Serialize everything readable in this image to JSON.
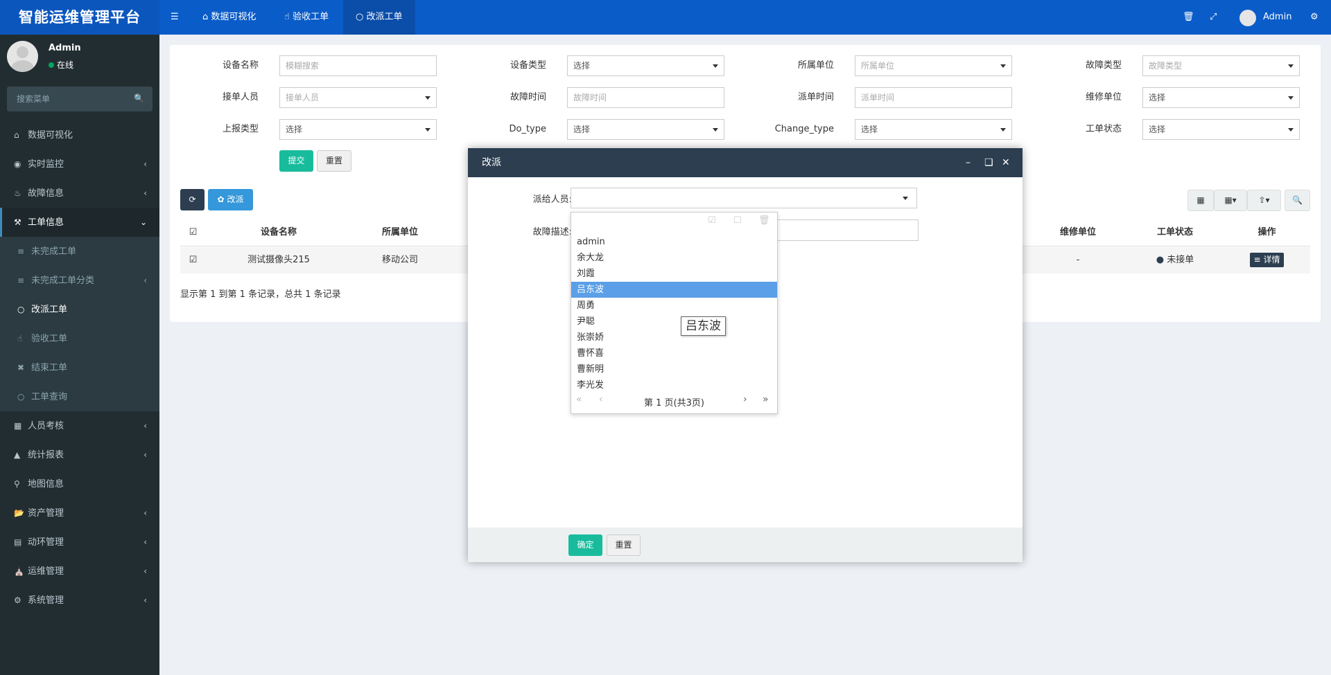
{
  "app": {
    "title": "智能运维管理平台"
  },
  "header": {
    "tabs": [
      {
        "label": "数据可视化",
        "icon": "home-icon"
      },
      {
        "label": "验收工单",
        "icon": "thumbs-up-icon"
      },
      {
        "label": "改派工单",
        "icon": "circle-icon"
      }
    ],
    "user": "Admin"
  },
  "sidebar": {
    "user": {
      "name": "Admin",
      "status": "在线"
    },
    "search_placeholder": "搜索菜单",
    "items": [
      {
        "label": "数据可视化"
      },
      {
        "label": "实时监控"
      },
      {
        "label": "故障信息"
      },
      {
        "label": "工单信息"
      },
      {
        "label": "人员考核"
      },
      {
        "label": "统计报表"
      },
      {
        "label": "地图信息"
      },
      {
        "label": "资产管理"
      },
      {
        "label": "动环管理"
      },
      {
        "label": "运维管理"
      },
      {
        "label": "系统管理"
      }
    ],
    "subitems": [
      {
        "label": "未完成工单"
      },
      {
        "label": "未完成工单分类"
      },
      {
        "label": "改派工单"
      },
      {
        "label": "验收工单"
      },
      {
        "label": "结束工单"
      },
      {
        "label": "工单查询"
      }
    ]
  },
  "filters": {
    "device_name": {
      "label": "设备名称",
      "placeholder": "模糊搜索"
    },
    "device_type": {
      "label": "设备类型",
      "value": "选择"
    },
    "unit": {
      "label": "所属单位",
      "placeholder": "所属单位"
    },
    "fault_type": {
      "label": "故障类型",
      "placeholder": "故障类型"
    },
    "receiver": {
      "label": "接单人员",
      "placeholder": "接单人员"
    },
    "fault_time": {
      "label": "故障时间",
      "placeholder": "故障时间"
    },
    "dispatch_time": {
      "label": "派单时间",
      "placeholder": "派单时间"
    },
    "repair_unit": {
      "label": "维修单位",
      "value": "选择"
    },
    "report_type": {
      "label": "上报类型",
      "value": "选择"
    },
    "do_type": {
      "label": "Do_type",
      "value": "选择"
    },
    "change_type": {
      "label": "Change_type",
      "value": "选择"
    },
    "order_status": {
      "label": "工单状态",
      "value": "选择"
    },
    "submit": "提交",
    "reset": "重置"
  },
  "toolbar": {
    "reassign": "改派"
  },
  "table": {
    "headers": [
      "设备名称",
      "所属单位",
      "维修单位",
      "工单状态",
      "操作"
    ],
    "row": {
      "device": "测试摄像头215",
      "unit": "移动公司",
      "repair_unit": "-",
      "status": "未接单",
      "action": "详情"
    },
    "info": "显示第 1 到第 1 条记录，总共 1 条记录"
  },
  "modal": {
    "title": "改派",
    "assignee_label": "派给人员:",
    "desc_label": "故障描述:",
    "confirm": "确定",
    "reset": "重置"
  },
  "dropdown": {
    "options": [
      "admin",
      "余大龙",
      "刘霞",
      "吕东波",
      "周勇",
      "尹聪",
      "张崇娇",
      "曹怀喜",
      "曹新明",
      "李光发"
    ],
    "selected_index": 3,
    "pager": "第 1 页(共3页)"
  },
  "tooltip": "吕东波",
  "colors": {
    "topbar": "#0a5cc8",
    "sidebar": "#222d32",
    "accent_green": "#18bc9c",
    "modal_header": "#2c3e50",
    "selected": "#5a9fe8"
  }
}
